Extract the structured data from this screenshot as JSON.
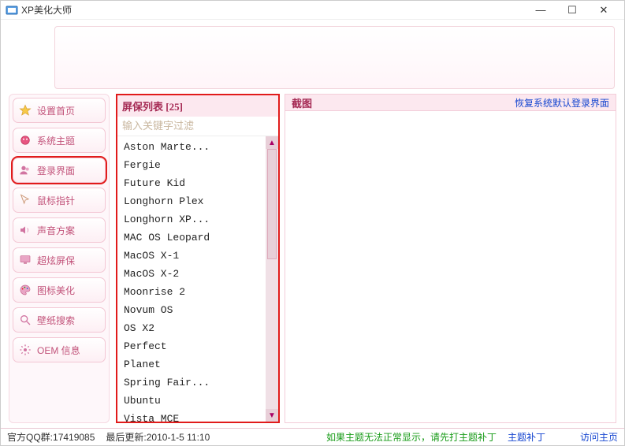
{
  "window": {
    "title": "XP美化大师"
  },
  "sidebar": {
    "items": [
      {
        "label": "设置首页"
      },
      {
        "label": "系统主题"
      },
      {
        "label": "登录界面"
      },
      {
        "label": "鼠标指针"
      },
      {
        "label": "声音方案"
      },
      {
        "label": "超炫屏保"
      },
      {
        "label": "图标美化"
      },
      {
        "label": "壁纸搜索"
      },
      {
        "label": "OEM 信息"
      }
    ]
  },
  "mid": {
    "header": "屏保列表 [25]",
    "filter_placeholder": "输入关键字过滤",
    "items": [
      "Aston Marte...",
      "Fergie",
      "Future Kid",
      "Longhorn Plex",
      "Longhorn XP...",
      "MAC OS Leopard",
      "MacOS X-1",
      "MacOS X-2",
      "Moonrise 2",
      "Novum OS",
      "OS X2",
      "Perfect",
      "Planet",
      "Spring Fair...",
      "Ubuntu",
      "Vista MCE"
    ]
  },
  "right": {
    "caption": "截图",
    "restore_link": "恢复系统默认登录界面"
  },
  "status": {
    "qq_label": "官方QQ群:",
    "qq_value": "17419085",
    "update_label": "最后更新:",
    "update_value": "2010-1-5 11:10",
    "warn_text": "如果主题无法正常显示，请先打主题补丁",
    "patch_link": "主题补丁",
    "home_link": "访问主页"
  }
}
